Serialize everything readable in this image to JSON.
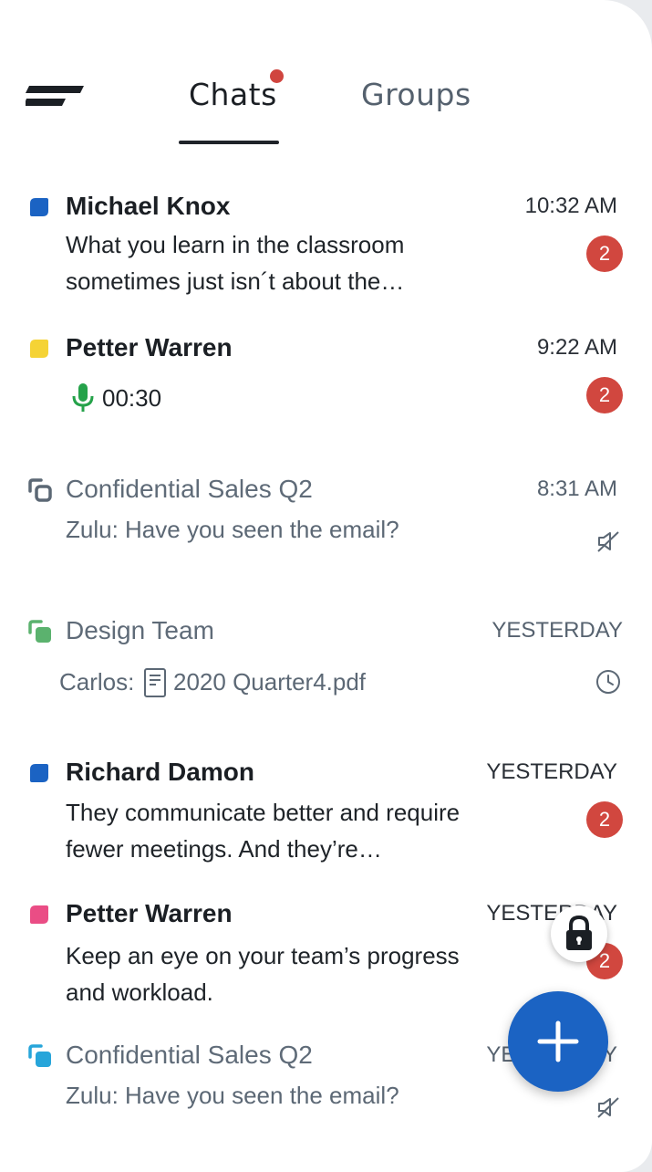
{
  "tabs": {
    "chats": "Chats",
    "groups": "Groups"
  },
  "chats": [
    {
      "name": "Michael Knox",
      "time": "10:32 AM",
      "message": "What you learn in the classroom sometimes just isn´t about the…",
      "badge": "2"
    },
    {
      "name": "Petter Warren",
      "time": "9:22 AM",
      "voice_duration": "00:30",
      "badge": "2"
    },
    {
      "name": "Confidential Sales Q2",
      "time": "8:31 AM",
      "message": "Zulu: Have you seen the email?"
    },
    {
      "name": "Design Team",
      "time": "YESTERDAY",
      "sender": "Carlos:",
      "file": "2020 Quarter4.pdf"
    },
    {
      "name": "Richard Damon",
      "time": "YESTERDAY",
      "message": "They communicate better and require fewer meetings. And they’re…",
      "badge": "2"
    },
    {
      "name": "Petter Warren",
      "time": "YESTERDAY",
      "message": "Keep an eye on your team’s progress and workload.",
      "badge": "2"
    },
    {
      "name": "Confidential Sales Q2",
      "time": "YESTERDAY",
      "message": "Zulu: Have you seen the email?"
    }
  ],
  "colors": {
    "accent": "#1b63c3",
    "badge": "#d1473f",
    "tag_blue": "#1b63c3",
    "tag_yellow": "#f5d335",
    "tag_green": "#5bb26e",
    "tag_pink": "#ea4d85",
    "tag_cyan": "#27a5da",
    "mic_green": "#25a24a"
  },
  "icons": {
    "menu": "menu-icon",
    "lock": "lock-icon",
    "add": "plus-icon",
    "mic": "microphone-icon",
    "file": "document-icon",
    "muted": "muted-speaker-icon",
    "scheduled": "clock-icon"
  }
}
